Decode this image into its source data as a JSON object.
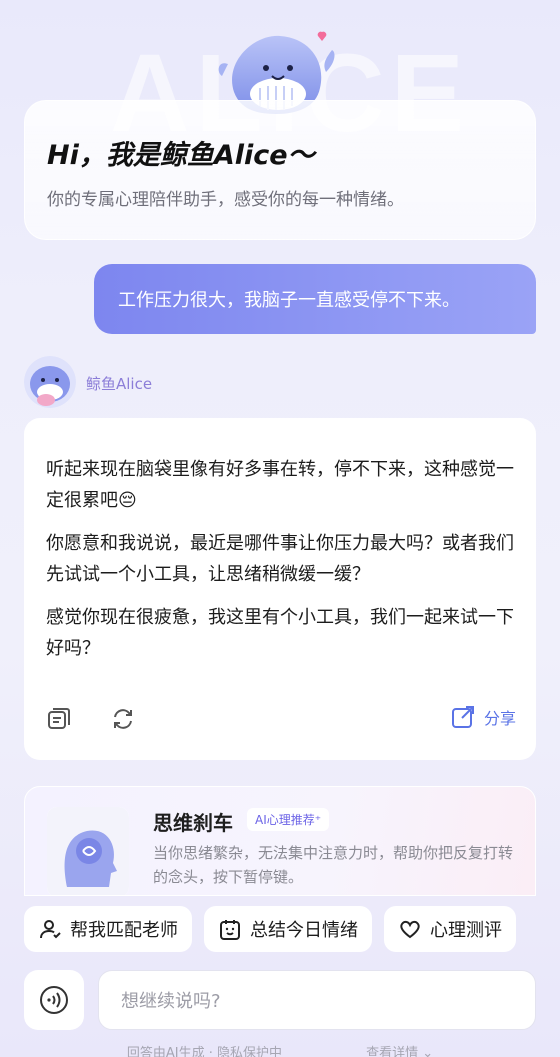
{
  "hero": {
    "bg_text": "ALICE",
    "title": "Hi，我是鲸鱼Alice～",
    "subtitle": "你的专属心理陪伴助手，感受你的每一种情绪。"
  },
  "user_message": "工作压力很大，我脑子一直感受停不下来。",
  "assistant": {
    "name": "鲸鱼Alice",
    "paragraphs": [
      "听起来现在脑袋里像有好多事在转，停不下来，这种感觉一定很累吧😔",
      "你愿意和我说说，最近是哪件事让你压力最大吗？或者我们先试试一个小工具，让思绪稍微缓一缓？",
      "感觉你现在很疲惫，我这里有个小工具，我们一起来试一下好吗？"
    ],
    "share_label": "分享"
  },
  "tool": {
    "title": "思维刹车",
    "badge": "AI心理推荐⁺",
    "description": "当你思绪繁杂，无法集中注意力时，帮助你把反复打转的念头，按下暂停键。"
  },
  "chips": [
    {
      "label": "帮我匹配老师",
      "icon": "person-icon"
    },
    {
      "label": "总结今日情绪",
      "icon": "mood-icon"
    },
    {
      "label": "心理测评",
      "icon": "heart-icon"
    }
  ],
  "input": {
    "placeholder": "想继续说吗?"
  },
  "footer": {
    "disclaimer": "回答由AI生成 · 隐私保护中",
    "details": "查看详情 ⌄"
  },
  "colors": {
    "accent": "#7d86ef",
    "share": "#5a73e6",
    "bot_name": "#8c7ed8"
  }
}
